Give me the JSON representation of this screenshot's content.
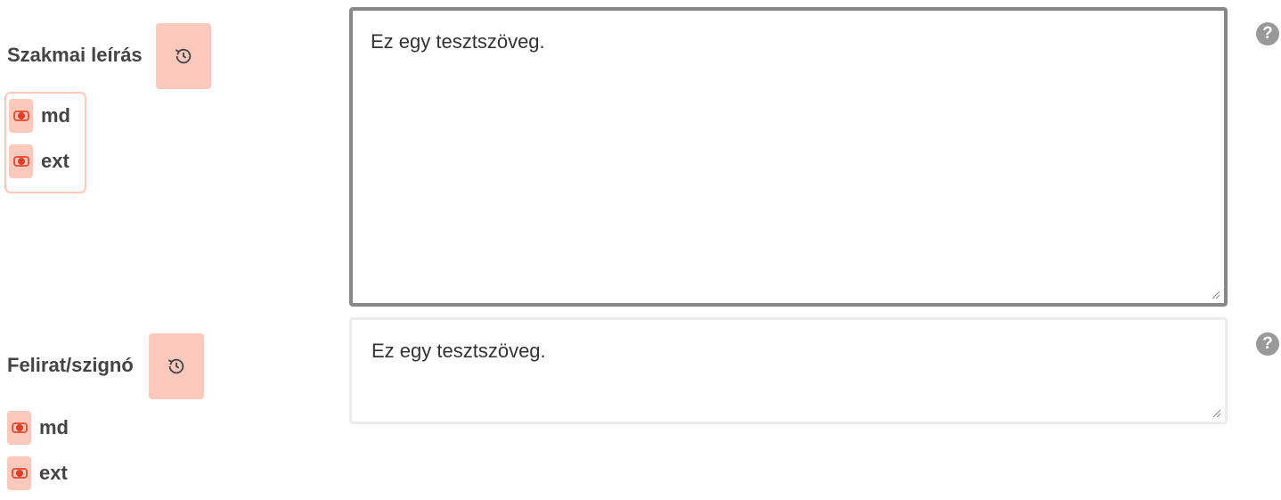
{
  "fields": [
    {
      "label": "Szakmai leírás",
      "value": "Ez egy tesztszöveg.",
      "toggles": [
        {
          "label": "md"
        },
        {
          "label": "ext"
        }
      ],
      "help_icon": "?",
      "focused": true
    },
    {
      "label": "Felirat/szignó",
      "value": "Ez egy tesztszöveg.",
      "toggles": [
        {
          "label": "md"
        },
        {
          "label": "ext"
        }
      ],
      "help_icon": "?",
      "focused": false
    }
  ],
  "icons": {
    "history": "history-icon",
    "toggle": "toggle-icon",
    "help": "help-icon"
  },
  "colors": {
    "accent_bg": "#fcc9bc",
    "accent": "#e8553a",
    "focus_border": "#888888",
    "help_icon": "#999999"
  }
}
